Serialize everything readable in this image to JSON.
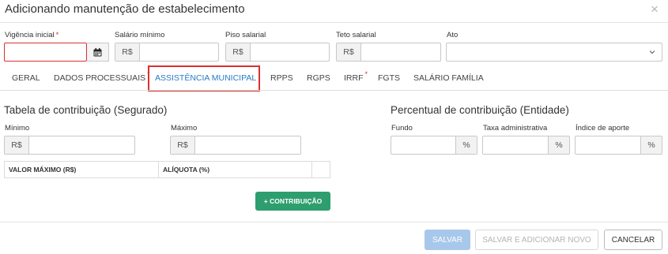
{
  "dialog": {
    "title": "Adicionando manutenção de estabelecimento",
    "close_icon": "×"
  },
  "top_fields": {
    "vigencia": {
      "label": "Vigência inicial",
      "required": "*",
      "value": ""
    },
    "salario_minimo": {
      "label": "Salário mínimo",
      "prefix": "R$",
      "value": ""
    },
    "piso_salarial": {
      "label": "Piso salarial",
      "prefix": "R$",
      "value": ""
    },
    "teto_salarial": {
      "label": "Teto salarial",
      "prefix": "R$",
      "value": ""
    },
    "ato": {
      "label": "Ato",
      "value": ""
    }
  },
  "tabs": [
    {
      "label": "GERAL"
    },
    {
      "label": "DADOS PROCESSUAIS",
      "required": "*"
    },
    {
      "label": "ASSISTÊNCIA MUNICIPAL",
      "active": true
    },
    {
      "label": "RPPS"
    },
    {
      "label": "RGPS"
    },
    {
      "label": "IRRF",
      "required": "*"
    },
    {
      "label": "FGTS"
    },
    {
      "label": "SALÁRIO FAMÍLIA"
    }
  ],
  "segurado": {
    "title": "Tabela de contribuição (Segurado)",
    "minimo": {
      "label": "Mínimo",
      "prefix": "R$",
      "value": ""
    },
    "maximo": {
      "label": "Máximo",
      "prefix": "R$",
      "value": ""
    },
    "table_headers": [
      "VALOR MÁXIMO (R$)",
      "ALÍQUOTA (%)",
      ""
    ],
    "add_button": "+ CONTRIBUIÇÃO"
  },
  "entidade": {
    "title": "Percentual de contribuição (Entidade)",
    "fundo": {
      "label": "Fundo",
      "suffix": "%",
      "value": ""
    },
    "taxa": {
      "label": "Taxa administrativa",
      "suffix": "%",
      "value": ""
    },
    "indice": {
      "label": "Índice de aporte",
      "suffix": "%",
      "value": ""
    }
  },
  "footer": {
    "salvar": "SALVAR",
    "salvar_novo": "SALVAR E ADICIONAR NOVO",
    "cancelar": "CANCELAR"
  },
  "colors": {
    "accent": "#2a7ac8",
    "required": "#d9302f",
    "success": "#2e9e6e",
    "primary_disabled": "#a7c8ea"
  }
}
